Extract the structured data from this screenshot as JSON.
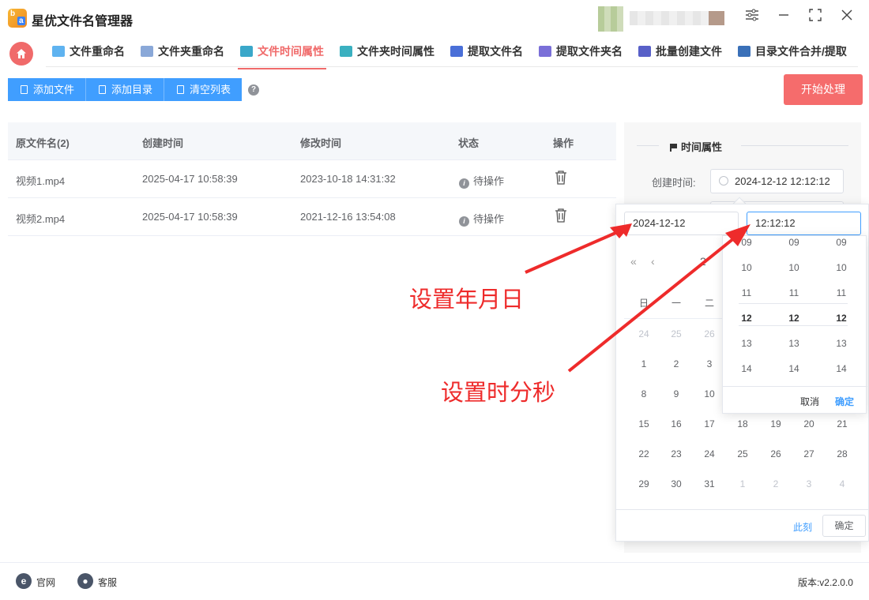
{
  "app": {
    "title": "星优文件名管理器"
  },
  "tabs": [
    {
      "label": "文件重命名",
      "color": "#5fb3f0"
    },
    {
      "label": "文件夹重命名",
      "color": "#8aa8d8"
    },
    {
      "label": "文件时间属性",
      "color": "#3aa7c9",
      "active": true
    },
    {
      "label": "文件夹时间属性",
      "color": "#3ab0c0"
    },
    {
      "label": "提取文件名",
      "color": "#4a6fd8"
    },
    {
      "label": "提取文件夹名",
      "color": "#7a6fd8"
    },
    {
      "label": "批量创建文件",
      "color": "#5860c8"
    },
    {
      "label": "目录文件合并/提取",
      "color": "#3a70b8"
    }
  ],
  "toolbar": {
    "add_file": "添加文件",
    "add_dir": "添加目录",
    "clear_list": "清空列表",
    "help": "?",
    "start": "开始处理"
  },
  "table": {
    "headers": [
      "原文件名(2)",
      "创建时间",
      "修改时间",
      "状态",
      "操作"
    ],
    "rows": [
      {
        "name": "视频1.mp4",
        "created": "2025-04-17 10:58:39",
        "modified": "2023-10-18 14:31:32",
        "status": "待操作"
      },
      {
        "name": "视频2.mp4",
        "created": "2025-04-17 10:58:39",
        "modified": "2021-12-16 13:54:08",
        "status": "待操作"
      }
    ]
  },
  "panel": {
    "title": "时间属性",
    "created_label": "创建时间:",
    "created_value": "2024-12-12 12:12:12"
  },
  "picker": {
    "date_value": "2024-12-12",
    "time_value": "12:12:12",
    "weekdays": [
      "日",
      "一",
      "二"
    ],
    "header_partial": "2",
    "days": [
      [
        "24",
        "25",
        "26",
        "",
        "",
        "",
        ""
      ],
      [
        "1",
        "2",
        "3",
        "",
        "",
        "",
        ""
      ],
      [
        "8",
        "9",
        "10",
        "",
        "",
        "",
        ""
      ],
      [
        "15",
        "16",
        "17",
        "18",
        "19",
        "20",
        "21"
      ],
      [
        "22",
        "23",
        "24",
        "25",
        "26",
        "27",
        "28"
      ],
      [
        "29",
        "30",
        "31",
        "1",
        "2",
        "3",
        "4"
      ]
    ],
    "now": "此刻",
    "ok": "确定"
  },
  "time_panel": {
    "hours": [
      "09",
      "10",
      "11",
      "12",
      "13",
      "14"
    ],
    "minutes": [
      "09",
      "10",
      "11",
      "12",
      "13",
      "14"
    ],
    "seconds": [
      "09",
      "10",
      "11",
      "12",
      "13",
      "14"
    ],
    "cancel": "取消",
    "ok": "确定"
  },
  "annotations": {
    "date": "设置年月日",
    "time": "设置时分秒"
  },
  "footer": {
    "website": "官网",
    "support": "客服",
    "version": "版本:v2.2.0.0"
  },
  "colors": {
    "accent": "#f06a6a",
    "primary": "#409eff",
    "annotation": "#ee2b2b"
  }
}
